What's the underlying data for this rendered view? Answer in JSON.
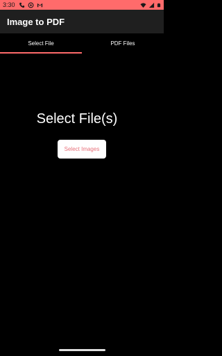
{
  "status_bar": {
    "time": "3:30",
    "left_icons": [
      "phone-icon",
      "vpn-icon",
      "gmail-icon"
    ],
    "right_icons": [
      "wifi-icon",
      "signal-icon",
      "battery-icon"
    ]
  },
  "app_bar": {
    "title": "Image to PDF"
  },
  "tabs": [
    {
      "label": "Select File",
      "selected": true
    },
    {
      "label": "PDF Files",
      "selected": false
    }
  ],
  "main": {
    "heading": "Select File(s)",
    "button_label": "Select Images"
  },
  "colors": {
    "accent": "#ff6b6b",
    "app_bar": "#1f1f1f",
    "background": "#000000",
    "button_text": "#e8707a"
  }
}
